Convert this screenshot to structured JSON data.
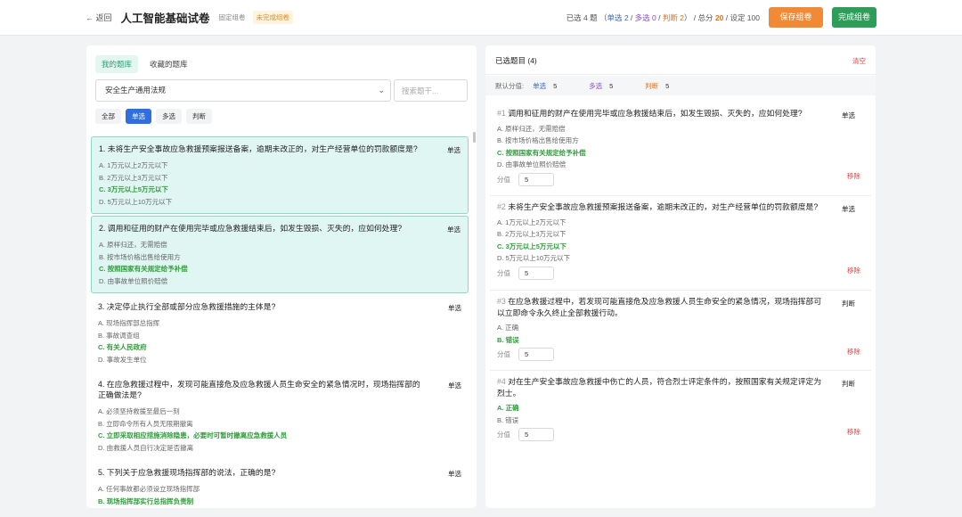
{
  "header": {
    "back_label": "← 返回",
    "title": "人工智能基础试卷",
    "fixed_tag": "固定组卷",
    "status_tag": "未完成组卷",
    "summary_prefix": "已选 ",
    "selected_count": "4",
    "summary_q": " 题 （",
    "single_label": "单选 2",
    "sep1": " / ",
    "multi_label": "多选 0",
    "sep2": " / ",
    "judge_label": "判断 2",
    "summary_mid": "） / 总分 ",
    "total_score": "20",
    "summary_set": " / 设定 100",
    "save_button": "保存组卷",
    "finish_button": "完成组卷"
  },
  "left": {
    "tabs": [
      {
        "label": "我的题库",
        "active": true
      },
      {
        "label": "收藏的题库",
        "active": false
      }
    ],
    "bank_select": "安全生产通用法规",
    "search_placeholder": "搜索题干...",
    "filters": [
      {
        "label": "全部",
        "active": false
      },
      {
        "label": "单选",
        "active": true
      },
      {
        "label": "多选",
        "active": false
      },
      {
        "label": "判断",
        "active": false
      }
    ],
    "questions": [
      {
        "title": "1. 未将生产安全事故应急救援预案报送备案，逾期未改正的，对生产经营单位的罚款额度是?",
        "type": "单选",
        "selected": true,
        "options": [
          {
            "text": "A. 1万元以上2万元以下",
            "correct": false
          },
          {
            "text": "B. 2万元以上3万元以下",
            "correct": false
          },
          {
            "text": "C. 3万元以上5万元以下",
            "correct": true
          },
          {
            "text": "D. 5万元以上10万元以下",
            "correct": false
          }
        ]
      },
      {
        "title": "2. 调用和征用的财产在使用完毕或应急救援结束后，如发生毁损、灭失的，应如何处理?",
        "type": "单选",
        "selected": true,
        "options": [
          {
            "text": "A. 原样归还，无需赔偿",
            "correct": false
          },
          {
            "text": "B. 按市场价格出售给使用方",
            "correct": false
          },
          {
            "text": "C. 按照国家有关规定给予补偿",
            "correct": true
          },
          {
            "text": "D. 由事故单位照价赔偿",
            "correct": false
          }
        ]
      },
      {
        "title": "3. 决定停止执行全部或部分应急救援措施的主体是?",
        "type": "单选",
        "selected": false,
        "options": [
          {
            "text": "A. 现场指挥部总指挥",
            "correct": false
          },
          {
            "text": "B. 事故调查组",
            "correct": false
          },
          {
            "text": "C. 有关人民政府",
            "correct": true
          },
          {
            "text": "D. 事故发生单位",
            "correct": false
          }
        ]
      },
      {
        "title": "4. 在应急救援过程中，发现可能直接危及应急救援人员生命安全的紧急情况时，现场指挥部的正确做法是?",
        "type": "单选",
        "selected": false,
        "options": [
          {
            "text": "A. 必须坚持救援至最后一刻",
            "correct": false
          },
          {
            "text": "B. 立即命令所有人员无限期撤离",
            "correct": false
          },
          {
            "text": "C. 立即采取相应措施消除隐患，必要时可暂时撤离应急救援人员",
            "correct": true
          },
          {
            "text": "D. 由救援人员自行决定是否撤离",
            "correct": false
          }
        ]
      },
      {
        "title": "5. 下列关于应急救援现场指挥部的说法，正确的是?",
        "type": "单选",
        "selected": false,
        "options": [
          {
            "text": "A. 任何事故都必须设立现场指挥部",
            "correct": false
          },
          {
            "text": "B. 现场指挥部实行总指挥负责制",
            "correct": true
          }
        ]
      }
    ]
  },
  "right": {
    "title": "已选题目 (4)",
    "clear_label": "清空",
    "defaults_label": "默认分值:",
    "defaults": [
      {
        "type": "单选",
        "value": "5",
        "color": "#3a66d9"
      },
      {
        "type": "多选",
        "value": "5",
        "color": "#8a4bd6"
      },
      {
        "type": "判断",
        "value": "5",
        "color": "#e0701e"
      }
    ],
    "score_label": "分值",
    "remove_label": "移除",
    "selected": [
      {
        "index": "#1",
        "title": "调用和征用的财产在使用完毕或应急救援结束后，如发生毁损、灭失的，应如何处理?",
        "type": "单选",
        "score": "5",
        "options": [
          {
            "text": "A. 原样归还，无需赔偿",
            "correct": false
          },
          {
            "text": "B. 按市场价格出售给使用方",
            "correct": false
          },
          {
            "text": "C. 按照国家有关规定给予补偿",
            "correct": true
          },
          {
            "text": "D. 由事故单位照价赔偿",
            "correct": false
          }
        ]
      },
      {
        "index": "#2",
        "title": "未将生产安全事故应急救援预案报送备案，逾期未改正的，对生产经营单位的罚款额度是?",
        "type": "单选",
        "score": "5",
        "options": [
          {
            "text": "A. 1万元以上2万元以下",
            "correct": false
          },
          {
            "text": "B. 2万元以上3万元以下",
            "correct": false
          },
          {
            "text": "C. 3万元以上5万元以下",
            "correct": true
          },
          {
            "text": "D. 5万元以上10万元以下",
            "correct": false
          }
        ]
      },
      {
        "index": "#3",
        "title": "在应急救援过程中，若发现可能直接危及应急救援人员生命安全的紧急情况，现场指挥部可以立即命令永久终止全部救援行动。",
        "type": "判断",
        "score": "5",
        "options": [
          {
            "text": "A. 正确",
            "correct": false
          },
          {
            "text": "B. 错误",
            "correct": true
          }
        ]
      },
      {
        "index": "#4",
        "title": "对在生产安全事故应急救援中伤亡的人员，符合烈士评定条件的，按照国家有关规定评定为烈士。",
        "type": "判断",
        "score": "5",
        "options": [
          {
            "text": "A. 正确",
            "correct": true
          },
          {
            "text": "B. 错误",
            "correct": false
          }
        ]
      }
    ]
  }
}
